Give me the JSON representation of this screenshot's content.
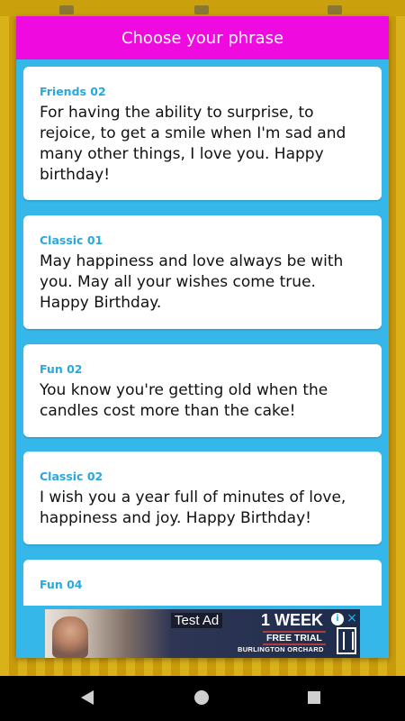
{
  "dialog": {
    "title": "Choose your phrase",
    "phrases": [
      {
        "category": "Friends 02",
        "text": "For having the ability to surprise, to rejoice, to get a smile when I'm sad and many other things, I love you. Happy birthday!"
      },
      {
        "category": "Classic 01",
        "text": "May happiness and love always be with you. May all your wishes come true. Happy Birthday."
      },
      {
        "category": "Fun 02",
        "text": "You know you're getting old when the candles cost more than the cake!"
      },
      {
        "category": "Classic 02",
        "text": "I wish you a year full of minutes of love, happiness and joy. Happy Birthday!"
      },
      {
        "category": "Fun 04",
        "text": ""
      }
    ]
  },
  "ad": {
    "label": "Test Ad",
    "headline": "1 WEEK",
    "subline": "FREE TRIAL",
    "brand": "BURLINGTON ORCHARD",
    "info_icon": "info-icon",
    "close_icon": "close-icon"
  },
  "navigation": {
    "back_icon": "back-triangle-icon",
    "home_icon": "home-circle-icon",
    "recents_icon": "recents-square-icon"
  },
  "colors": {
    "header": "#ef0ae0",
    "dialog_background": "#36b7ea",
    "category_text": "#27a9de",
    "card": "#ffffff"
  }
}
